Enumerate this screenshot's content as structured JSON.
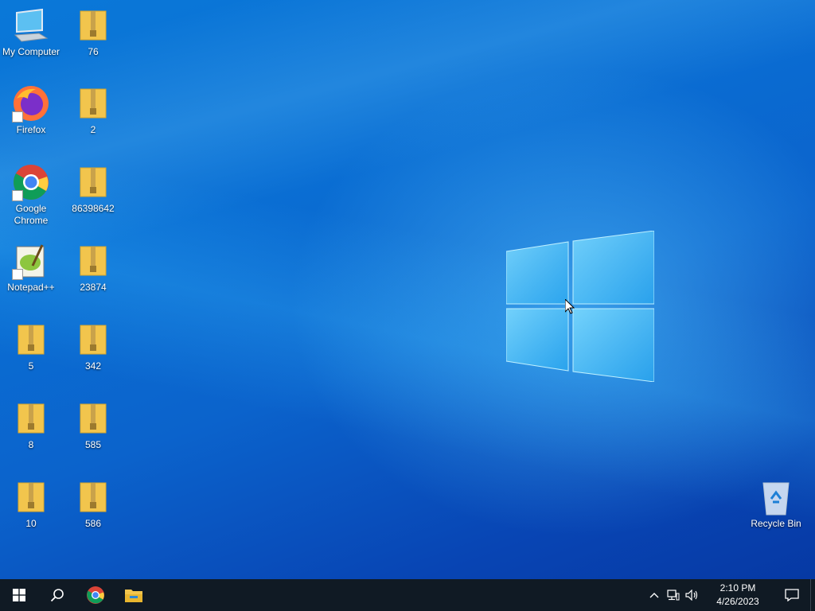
{
  "desktop": {
    "icons": [
      {
        "label": "My Computer",
        "type": "computer-icon"
      },
      {
        "label": "Firefox",
        "type": "firefox-icon"
      },
      {
        "label": "Google Chrome",
        "type": "chrome-icon"
      },
      {
        "label": "Notepad++",
        "type": "notepadpp-icon"
      },
      {
        "label": "5",
        "type": "zip-folder-icon"
      },
      {
        "label": "8",
        "type": "zip-folder-icon"
      },
      {
        "label": "10",
        "type": "zip-folder-icon"
      },
      {
        "label": "76",
        "type": "zip-folder-icon"
      },
      {
        "label": "2",
        "type": "zip-folder-icon"
      },
      {
        "label": "86398642",
        "type": "zip-folder-icon"
      },
      {
        "label": "23874",
        "type": "zip-folder-icon"
      },
      {
        "label": "342",
        "type": "zip-folder-icon"
      },
      {
        "label": "585",
        "type": "zip-folder-icon"
      },
      {
        "label": "586",
        "type": "zip-folder-icon"
      }
    ],
    "recycle_bin": {
      "label": "Recycle Bin"
    }
  },
  "taskbar": {
    "start": "windows-start-icon",
    "search": "search-icon",
    "pinned": [
      "chrome-icon",
      "file-explorer-icon"
    ],
    "clock": {
      "time": "2:10 PM",
      "date": "4/26/2023"
    }
  },
  "colors": {
    "taskbar_bg": "#101a24",
    "wallpaper_main": "#0a6fd4",
    "folder_yellow": "#f2c54d"
  }
}
